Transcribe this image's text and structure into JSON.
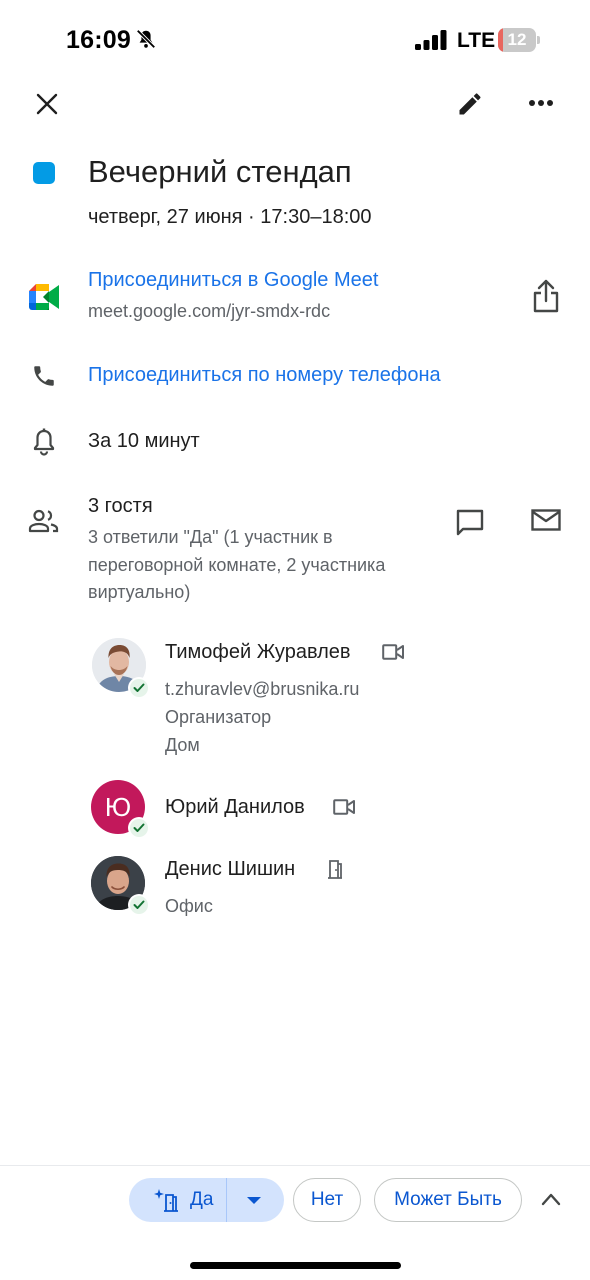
{
  "status_bar": {
    "time": "16:09",
    "network": "LTE",
    "battery": "12",
    "battery_level": 0.12
  },
  "toolbar": {
    "close_icon": "close-icon",
    "edit_icon": "pencil-icon",
    "more_icon": "more-horizontal-icon"
  },
  "event": {
    "title": "Вечерний стендап",
    "datetime": "четверг, 27 июня · 17:30–18:00",
    "color": "#039be5"
  },
  "meet": {
    "join_label": "Присоединиться в Google Meet",
    "url": "meet.google.com/jyr-smdx-rdc"
  },
  "phone": {
    "join_label": "Присоединиться по номеру телефона"
  },
  "reminder": {
    "label": "За 10 минут"
  },
  "guests": {
    "count_label": "3 гостя",
    "summary": "3 ответили \"Да\" (1 участник в переговорной комнате, 2 участника виртуально)",
    "list": [
      {
        "name": "Тимофей Журавлев",
        "email": "t.zhuravlev@brusnika.ru",
        "role": "Организатор",
        "location": "Дом",
        "mode_icon": "video-camera-icon"
      },
      {
        "name": "Юрий Данилов",
        "initial": "Ю",
        "avatar_color": "#c2185b",
        "mode_icon": "video-camera-icon"
      },
      {
        "name": "Денис Шишин",
        "location": "Офис",
        "mode_icon": "meeting-room-icon"
      }
    ]
  },
  "rsvp": {
    "yes": "Да",
    "no": "Нет",
    "maybe": "Может Быть"
  }
}
